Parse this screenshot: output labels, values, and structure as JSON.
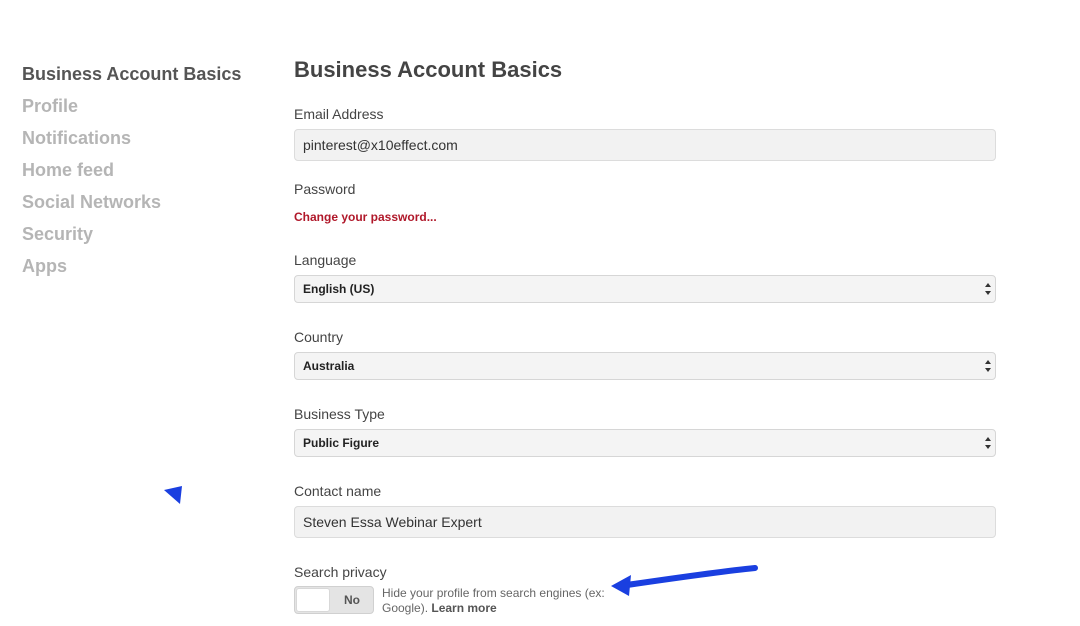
{
  "sidebar": {
    "items": [
      {
        "label": "Business Account Basics"
      },
      {
        "label": "Profile"
      },
      {
        "label": "Notifications"
      },
      {
        "label": "Home feed"
      },
      {
        "label": "Social Networks"
      },
      {
        "label": "Security"
      },
      {
        "label": "Apps"
      }
    ]
  },
  "main": {
    "title": "Business Account Basics",
    "email": {
      "label": "Email Address",
      "value": "pinterest@x10effect.com"
    },
    "password": {
      "label": "Password",
      "link": "Change your password..."
    },
    "language": {
      "label": "Language",
      "selected": "English (US)"
    },
    "country": {
      "label": "Country",
      "selected": "Australia"
    },
    "business_type": {
      "label": "Business Type",
      "selected": "Public Figure"
    },
    "contact_name": {
      "label": "Contact name",
      "value": "Steven Essa Webinar Expert"
    },
    "search_privacy": {
      "label": "Search privacy",
      "toggle_text": "No",
      "description": "Hide your profile from search engines (ex: Google).",
      "learn_more": "Learn more"
    }
  },
  "colors": {
    "link_red": "#b0182a",
    "annotation_blue": "#1a3fe0",
    "sidebar_active": "#555555",
    "sidebar_inactive": "#b5b5b5"
  }
}
